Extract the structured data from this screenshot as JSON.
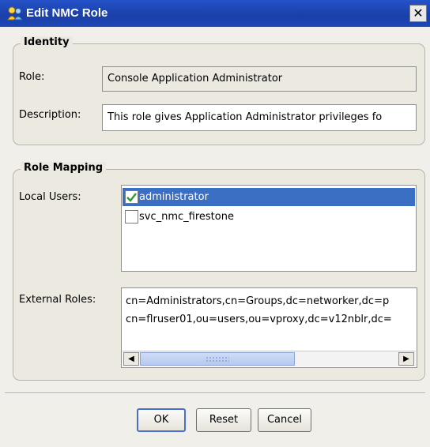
{
  "window": {
    "title": "Edit NMC Role",
    "close_glyph": "✕"
  },
  "identity": {
    "group_title": "Identity",
    "role_label": "Role:",
    "role_value": "Console Application Administrator",
    "description_label": "Description:",
    "description_value": "This role gives Application Administrator privileges fo"
  },
  "role_mapping": {
    "group_title": "Role Mapping",
    "local_users_label": "Local Users:",
    "local_users": [
      {
        "name": "administrator",
        "checked": true,
        "selected": true
      },
      {
        "name": "svc_nmc_firestone",
        "checked": false,
        "selected": false
      }
    ],
    "external_roles_label": "External Roles:",
    "external_roles": [
      "cn=Administrators,cn=Groups,dc=networker,dc=p",
      "cn=flruser01,ou=users,ou=vproxy,dc=v12nblr,dc="
    ]
  },
  "buttons": {
    "ok": "OK",
    "reset": "Reset",
    "cancel": "Cancel"
  },
  "icons": {
    "window": "role-people-icon",
    "check": "checkmark-icon",
    "scroll_left": "arrow-left-icon",
    "scroll_right": "arrow-right-icon"
  },
  "colors": {
    "titlebar": "#2452c8",
    "selection": "#3a6fc4",
    "check": "#2e9a2e"
  }
}
